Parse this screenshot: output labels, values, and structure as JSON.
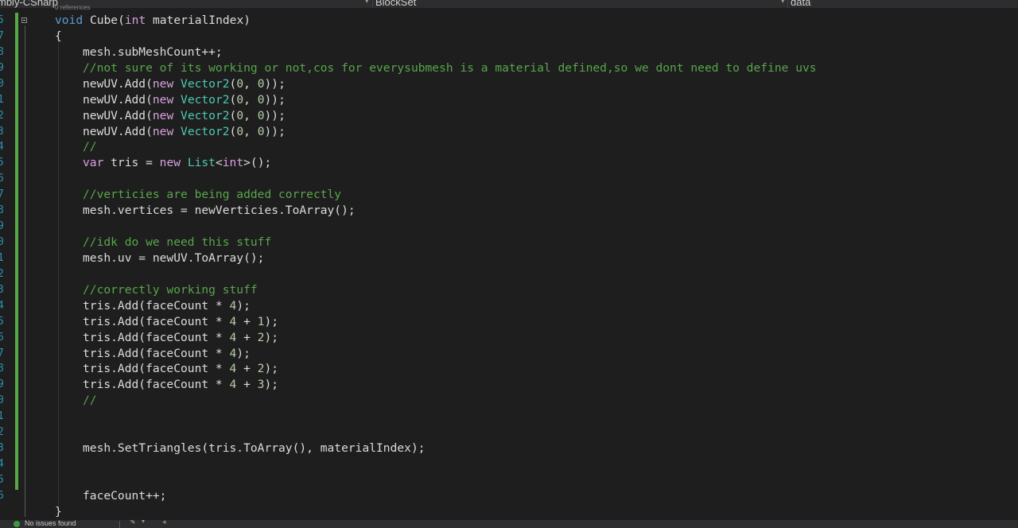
{
  "navbar": {
    "project": "mbly-CSharp",
    "class": "BlockSet",
    "member": "data"
  },
  "editor": {
    "codelens": "0 references",
    "line_numbers": [
      "5",
      "7",
      "8",
      "9",
      "0",
      "1",
      "2",
      "3",
      "4",
      "5",
      "6",
      "7",
      "8",
      "9",
      "0",
      "1",
      "2",
      "3",
      "4",
      "5",
      "6",
      "7",
      "8",
      "9",
      "0",
      "1",
      "2",
      "3",
      "4",
      "5",
      "6"
    ],
    "lines": [
      {
        "indent": 0,
        "tokens": [
          {
            "t": "kw",
            "v": "void"
          },
          {
            "t": "p",
            "v": " Cube("
          },
          {
            "t": "kwc",
            "v": "int"
          },
          {
            "t": "p",
            "v": " materialIndex)"
          }
        ]
      },
      {
        "indent": 0,
        "tokens": [
          {
            "t": "p",
            "v": "{"
          }
        ]
      },
      {
        "indent": 1,
        "tokens": [
          {
            "t": "p",
            "v": "mesh.subMeshCount++;"
          }
        ]
      },
      {
        "indent": 1,
        "tokens": [
          {
            "t": "cm",
            "v": "//not sure of its working or not,cos for everysubmesh is a material defined,so we dont need to define uvs"
          }
        ]
      },
      {
        "indent": 1,
        "tokens": [
          {
            "t": "p",
            "v": "newUV.Add("
          },
          {
            "t": "kwc",
            "v": "new"
          },
          {
            "t": "p",
            "v": " "
          },
          {
            "t": "ty",
            "v": "Vector2"
          },
          {
            "t": "p",
            "v": "("
          },
          {
            "t": "nm",
            "v": "0"
          },
          {
            "t": "p",
            "v": ", "
          },
          {
            "t": "nm",
            "v": "0"
          },
          {
            "t": "p",
            "v": "));"
          }
        ]
      },
      {
        "indent": 1,
        "tokens": [
          {
            "t": "p",
            "v": "newUV.Add("
          },
          {
            "t": "kwc",
            "v": "new"
          },
          {
            "t": "p",
            "v": " "
          },
          {
            "t": "ty",
            "v": "Vector2"
          },
          {
            "t": "p",
            "v": "("
          },
          {
            "t": "nm",
            "v": "0"
          },
          {
            "t": "p",
            "v": ", "
          },
          {
            "t": "nm",
            "v": "0"
          },
          {
            "t": "p",
            "v": "));"
          }
        ]
      },
      {
        "indent": 1,
        "tokens": [
          {
            "t": "p",
            "v": "newUV.Add("
          },
          {
            "t": "kwc",
            "v": "new"
          },
          {
            "t": "p",
            "v": " "
          },
          {
            "t": "ty",
            "v": "Vector2"
          },
          {
            "t": "p",
            "v": "("
          },
          {
            "t": "nm",
            "v": "0"
          },
          {
            "t": "p",
            "v": ", "
          },
          {
            "t": "nm",
            "v": "0"
          },
          {
            "t": "p",
            "v": "));"
          }
        ]
      },
      {
        "indent": 1,
        "tokens": [
          {
            "t": "p",
            "v": "newUV.Add("
          },
          {
            "t": "kwc",
            "v": "new"
          },
          {
            "t": "p",
            "v": " "
          },
          {
            "t": "ty",
            "v": "Vector2"
          },
          {
            "t": "p",
            "v": "("
          },
          {
            "t": "nm",
            "v": "0"
          },
          {
            "t": "p",
            "v": ", "
          },
          {
            "t": "nm",
            "v": "0"
          },
          {
            "t": "p",
            "v": "));"
          }
        ]
      },
      {
        "indent": 1,
        "tokens": [
          {
            "t": "cm",
            "v": "//"
          }
        ]
      },
      {
        "indent": 1,
        "tokens": [
          {
            "t": "kwc",
            "v": "var"
          },
          {
            "t": "p",
            "v": " tris = "
          },
          {
            "t": "kwc",
            "v": "new"
          },
          {
            "t": "p",
            "v": " "
          },
          {
            "t": "ty",
            "v": "List"
          },
          {
            "t": "p",
            "v": "<"
          },
          {
            "t": "kwc",
            "v": "int"
          },
          {
            "t": "p",
            "v": ">();"
          }
        ]
      },
      {
        "indent": 1,
        "tokens": []
      },
      {
        "indent": 1,
        "tokens": [
          {
            "t": "cm",
            "v": "//verticies are being added correctly"
          }
        ]
      },
      {
        "indent": 1,
        "tokens": [
          {
            "t": "p",
            "v": "mesh.vertices = newVerticies.ToArray();"
          }
        ]
      },
      {
        "indent": 1,
        "tokens": []
      },
      {
        "indent": 1,
        "tokens": [
          {
            "t": "cm",
            "v": "//idk do we need this stuff"
          }
        ]
      },
      {
        "indent": 1,
        "tokens": [
          {
            "t": "p",
            "v": "mesh.uv = newUV.ToArray();"
          }
        ]
      },
      {
        "indent": 1,
        "tokens": []
      },
      {
        "indent": 1,
        "tokens": [
          {
            "t": "cm",
            "v": "//correctly working stuff"
          }
        ]
      },
      {
        "indent": 1,
        "tokens": [
          {
            "t": "p",
            "v": "tris.Add(faceCount * "
          },
          {
            "t": "nm",
            "v": "4"
          },
          {
            "t": "p",
            "v": ");"
          }
        ]
      },
      {
        "indent": 1,
        "tokens": [
          {
            "t": "p",
            "v": "tris.Add(faceCount * "
          },
          {
            "t": "nm",
            "v": "4"
          },
          {
            "t": "p",
            "v": " + "
          },
          {
            "t": "nm",
            "v": "1"
          },
          {
            "t": "p",
            "v": ");"
          }
        ]
      },
      {
        "indent": 1,
        "tokens": [
          {
            "t": "p",
            "v": "tris.Add(faceCount * "
          },
          {
            "t": "nm",
            "v": "4"
          },
          {
            "t": "p",
            "v": " + "
          },
          {
            "t": "nm",
            "v": "2"
          },
          {
            "t": "p",
            "v": ");"
          }
        ]
      },
      {
        "indent": 1,
        "tokens": [
          {
            "t": "p",
            "v": "tris.Add(faceCount * "
          },
          {
            "t": "nm",
            "v": "4"
          },
          {
            "t": "p",
            "v": ");"
          }
        ]
      },
      {
        "indent": 1,
        "tokens": [
          {
            "t": "p",
            "v": "tris.Add(faceCount * "
          },
          {
            "t": "nm",
            "v": "4"
          },
          {
            "t": "p",
            "v": " + "
          },
          {
            "t": "nm",
            "v": "2"
          },
          {
            "t": "p",
            "v": ");"
          }
        ]
      },
      {
        "indent": 1,
        "tokens": [
          {
            "t": "p",
            "v": "tris.Add(faceCount * "
          },
          {
            "t": "nm",
            "v": "4"
          },
          {
            "t": "p",
            "v": " + "
          },
          {
            "t": "nm",
            "v": "3"
          },
          {
            "t": "p",
            "v": ");"
          }
        ]
      },
      {
        "indent": 1,
        "tokens": [
          {
            "t": "cm",
            "v": "//"
          }
        ]
      },
      {
        "indent": 1,
        "tokens": []
      },
      {
        "indent": 1,
        "tokens": []
      },
      {
        "indent": 1,
        "tokens": [
          {
            "t": "p",
            "v": "mesh.SetTriangles(tris.ToArray(), materialIndex);"
          }
        ]
      },
      {
        "indent": 1,
        "tokens": []
      },
      {
        "indent": 1,
        "tokens": []
      },
      {
        "indent": 1,
        "tokens": [
          {
            "t": "p",
            "v": "faceCount++;"
          }
        ]
      },
      {
        "indent": 0,
        "tokens": [
          {
            "t": "p",
            "v": "}"
          }
        ]
      }
    ]
  },
  "statusbar": {
    "issues": "No issues found"
  },
  "colors": {
    "background": "#1e1e1e",
    "keyword": "#569cd6",
    "control_keyword": "#d8a0df",
    "type": "#4ec9b0",
    "number": "#b5cea8",
    "comment": "#57a64a",
    "line_number": "#2b91af"
  },
  "icons": {
    "status": "check-circle-icon",
    "brush": "brush-icon",
    "dropdown": "chevron-down-icon"
  }
}
